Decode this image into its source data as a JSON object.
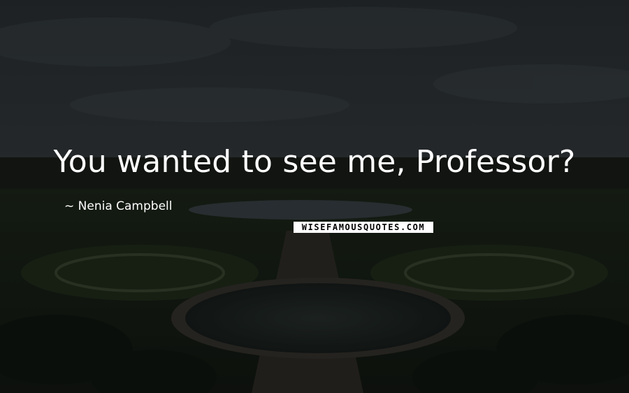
{
  "quote": {
    "text": "You wanted to see me, Professor?"
  },
  "author": {
    "text": "Nenia Campbell"
  },
  "brand": {
    "text": "WISEFAMOUSQUOTES.COM"
  }
}
